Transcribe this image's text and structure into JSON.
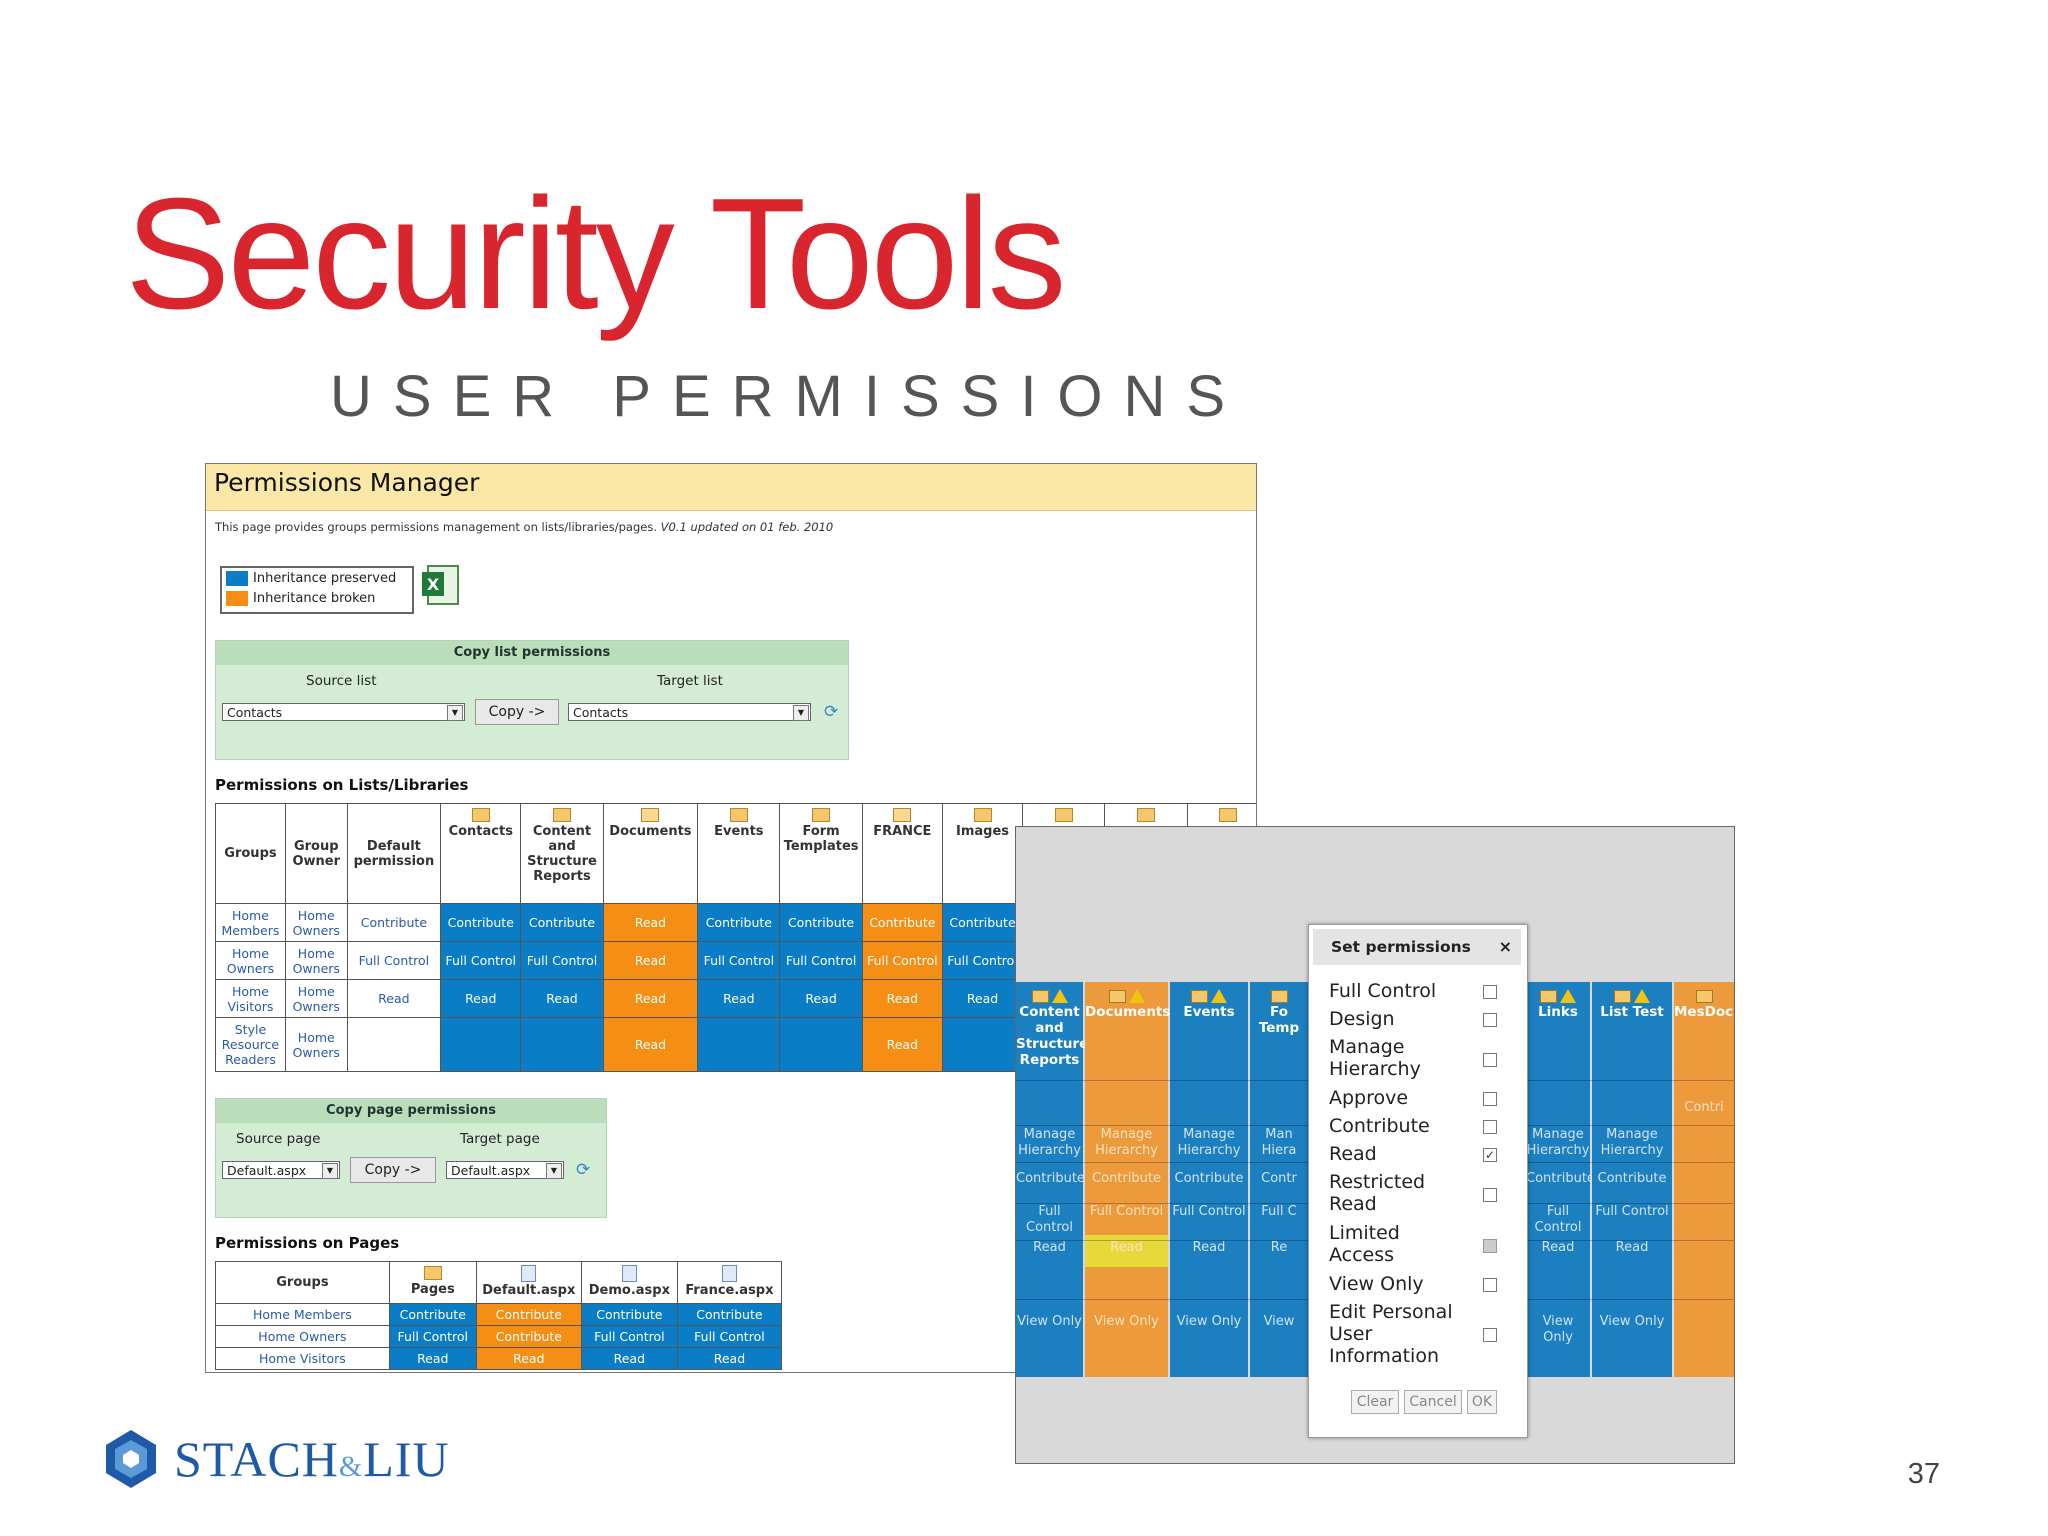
{
  "slide": {
    "title": "Security Tools",
    "subtitle": "USER PERMISSIONS",
    "page_number": "37",
    "logo_main": "STACH",
    "logo_amp": "&",
    "logo_end": "LIU"
  },
  "pm": {
    "header": "Permissions Manager",
    "desc_plain": "This page provides groups permissions management on lists/libraries/pages.",
    "desc_version": "V0.1 updated on 01 feb. 2010",
    "legend": {
      "preserved": "Inheritance preserved",
      "broken": "Inheritance broken",
      "preserved_color": "#0a7dc6",
      "broken_color": "#f58e14"
    },
    "copy_list": {
      "title": "Copy list permissions",
      "source_label": "Source list",
      "target_label": "Target list",
      "source_value": "Contacts",
      "target_value": "Contacts",
      "button": "Copy ->"
    },
    "lists_section": "Permissions on Lists/Libraries",
    "lists_table": {
      "h_groups": "Groups",
      "h_owner": "Group Owner",
      "h_default": "Default permission",
      "columns": [
        "Contacts",
        "Content and Structure Reports",
        "Documents",
        "Events",
        "Form Templates",
        "FRANCE",
        "Images"
      ],
      "rows": [
        {
          "group": "Home Members",
          "owner": "Home Owners",
          "default": "Contribute",
          "cells": [
            "Contribute",
            "Contribute",
            "Read",
            "Contribute",
            "Contribute",
            "Contribute",
            "Contribute"
          ]
        },
        {
          "group": "Home Owners",
          "owner": "Home Owners",
          "default": "Full Control",
          "cells": [
            "Full Control",
            "Full Control",
            "Read",
            "Full Control",
            "Full Control",
            "Full Control",
            "Full Control"
          ]
        },
        {
          "group": "Home Visitors",
          "owner": "Home Owners",
          "default": "Read",
          "cells": [
            "Read",
            "Read",
            "Read",
            "Read",
            "Read",
            "Read",
            "Read"
          ]
        },
        {
          "group": "Style Resource Readers",
          "owner": "Home Owners",
          "default": "",
          "cells": [
            "",
            "",
            "Read",
            "",
            "",
            "Read",
            ""
          ]
        }
      ]
    },
    "copy_page": {
      "title": "Copy page permissions",
      "source_label": "Source page",
      "target_label": "Target page",
      "source_value": "Default.aspx",
      "target_value": "Default.aspx",
      "button": "Copy ->"
    },
    "pages_section": "Permissions on Pages",
    "pages_table": {
      "h_groups": "Groups",
      "columns": [
        "Pages",
        "Default.aspx",
        "Demo.aspx",
        "France.aspx"
      ],
      "rows": [
        {
          "group": "Home Members",
          "cells": [
            "Contribute",
            "Contribute",
            "Contribute",
            "Contribute"
          ]
        },
        {
          "group": "Home Owners",
          "cells": [
            "Full Control",
            "Contribute",
            "Full Control",
            "Full Control"
          ]
        },
        {
          "group": "Home Visitors",
          "cells": [
            "Read",
            "Read",
            "Read",
            "Read"
          ]
        }
      ]
    }
  },
  "grid2": {
    "cols": [
      {
        "header": "Content and Structure Reports",
        "cells": [
          "",
          "Manage Hierarchy",
          "Contribute",
          "Full Control",
          "Read",
          "",
          "View Only"
        ]
      },
      {
        "header": "Documents",
        "cells": [
          "",
          "Manage Hierarchy",
          "Contribute",
          "Full Control",
          "Read",
          "",
          "View Only"
        ]
      },
      {
        "header": "Events",
        "cells": [
          "",
          "Manage Hierarchy",
          "Contribute",
          "Full Control",
          "Read",
          "",
          "View Only"
        ]
      },
      {
        "header": "Fo Temp",
        "cells": [
          "",
          "Man Hiera",
          "Contr",
          "Full C",
          "Re",
          "",
          "View"
        ]
      },
      {
        "header": "Links",
        "cells": [
          "",
          "Manage Hierarchy",
          "Contribute",
          "Full Control",
          "Read",
          "",
          "View Only"
        ]
      },
      {
        "header": "List Test",
        "cells": [
          "",
          "Manage Hierarchy",
          "Contribute",
          "Full Control",
          "Read",
          "",
          "View Only"
        ]
      },
      {
        "header": "MesDocu",
        "cells": [
          "Contri",
          "",
          "",
          "",
          "",
          "",
          ""
        ]
      }
    ]
  },
  "dialog": {
    "title": "Set permissions",
    "close": "×",
    "options": [
      {
        "label": "Full Control",
        "checked": false
      },
      {
        "label": "Design",
        "checked": false
      },
      {
        "label": "Manage Hierarchy",
        "checked": false
      },
      {
        "label": "Approve",
        "checked": false
      },
      {
        "label": "Contribute",
        "checked": false
      },
      {
        "label": "Read",
        "checked": true
      },
      {
        "label": "Restricted Read",
        "checked": false
      },
      {
        "label": "Limited Access",
        "checked": false
      },
      {
        "label": "View Only",
        "checked": false
      },
      {
        "label": "Edit Personal User Information",
        "checked": false
      }
    ],
    "clear": "Clear",
    "cancel": "Cancel",
    "ok": "OK"
  }
}
